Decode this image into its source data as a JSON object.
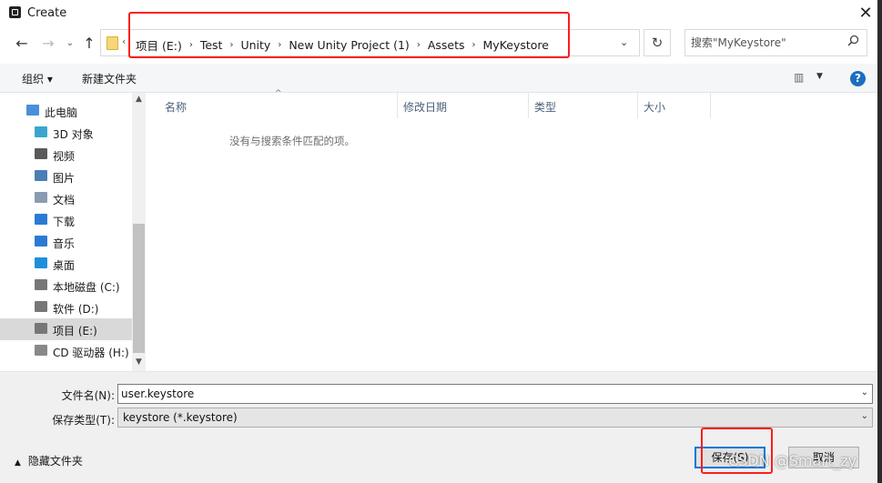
{
  "window": {
    "title": "Create",
    "close": "✕"
  },
  "nav": {
    "back": "←",
    "forward": "→",
    "recent": "⌄",
    "up": "↑",
    "refresh": "↻"
  },
  "address": {
    "chevron_left": "‹",
    "crumbs": [
      "项目 (E:)",
      "Test",
      "Unity",
      "New Unity Project (1)",
      "Assets",
      "MyKeystore"
    ],
    "separator": "›",
    "dropdown": "⌄"
  },
  "search": {
    "placeholder": "搜索\"MyKeystore\"",
    "icon": "search-icon"
  },
  "toolbar": {
    "organize": "组织 ▾",
    "new_folder": "新建文件夹",
    "view": "▥ ",
    "view_drop": "▼",
    "help": "?"
  },
  "sidebar": {
    "items": [
      {
        "label": "此电脑",
        "icon": "computer-icon",
        "color": "#4a90d9",
        "indent": 0
      },
      {
        "label": "3D 对象",
        "icon": "cube-icon",
        "color": "#3aa6d0",
        "indent": 1
      },
      {
        "label": "视频",
        "icon": "film-icon",
        "color": "#5a5a5a",
        "indent": 1
      },
      {
        "label": "图片",
        "icon": "picture-icon",
        "color": "#4a7fb5",
        "indent": 1
      },
      {
        "label": "文档",
        "icon": "document-icon",
        "color": "#8a9bb0",
        "indent": 1
      },
      {
        "label": "下载",
        "icon": "download-icon",
        "color": "#2a7ad4",
        "indent": 1
      },
      {
        "label": "音乐",
        "icon": "music-icon",
        "color": "#2a7ad4",
        "indent": 1
      },
      {
        "label": "桌面",
        "icon": "desktop-icon",
        "color": "#1f8fdc",
        "indent": 1
      },
      {
        "label": "本地磁盘 (C:)",
        "icon": "drive-c-icon",
        "color": "#777777",
        "indent": 1
      },
      {
        "label": "软件 (D:)",
        "icon": "drive-icon",
        "color": "#777777",
        "indent": 1
      },
      {
        "label": "项目 (E:)",
        "icon": "drive-icon",
        "color": "#777777",
        "indent": 1,
        "selected": true
      },
      {
        "label": "CD 驱动器 (H:)",
        "icon": "cd-drive-icon",
        "color": "#888888",
        "indent": 1
      }
    ],
    "scroll_up": "▲",
    "scroll_down": "▼"
  },
  "filelist": {
    "columns": [
      "名称",
      "修改日期",
      "类型",
      "大小"
    ],
    "sort_indicator": "^",
    "empty_message": "没有与搜索条件匹配的项。"
  },
  "form": {
    "filename_label": "文件名(N):",
    "filename_value": "user.keystore",
    "filetype_label": "保存类型(T):",
    "filetype_value": "keystore (*.keystore)",
    "dropdown": "⌄"
  },
  "footer": {
    "hide_folders": "隐藏文件夹",
    "caret": "▲",
    "save": "保存(S)",
    "cancel": "取消"
  },
  "watermark": "CSDN @Smart_zy",
  "colors": {
    "highlight": "#ff1c1c",
    "accent": "#0078d7"
  }
}
